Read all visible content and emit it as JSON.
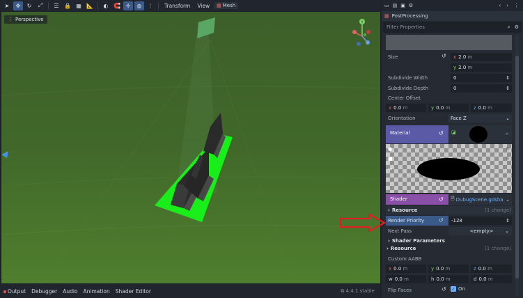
{
  "toolbar": {
    "menu_transform": "Transform",
    "menu_view": "View",
    "menu_mesh": "Mesh"
  },
  "viewport": {
    "perspective_label": "Perspective",
    "gizmo_y": "Y"
  },
  "bottom": {
    "output": "Output",
    "debugger": "Debugger",
    "audio": "Audio",
    "animation": "Animation",
    "shader_editor": "Shader Editor",
    "version": "4.4.1.stable"
  },
  "inspector": {
    "node_name": "PostProcessing",
    "filter_placeholder": "Filter Properties",
    "size_label": "Size",
    "size_x": "2.0",
    "size_y": "2.0",
    "unit_m": "m",
    "subdivide_width_label": "Subdivide Width",
    "subdivide_width": "0",
    "subdivide_depth_label": "Subdivide Depth",
    "subdivide_depth": "0",
    "center_offset_label": "Center Offset",
    "center_x": "0.0",
    "center_y": "0.0",
    "center_z": "0.0",
    "orientation_label": "Orientation",
    "orientation_value": "Face Z",
    "material_label": "Material",
    "shader_label": "Shader",
    "shader_value": "DubugScene.gdsha",
    "resource_label": "Resource",
    "resource_changes": "(1 change)",
    "render_priority_label": "Render Priority",
    "render_priority_value": "-128",
    "next_pass_label": "Next Pass",
    "next_pass_value": "<empty>",
    "shader_params_label": "Shader Parameters",
    "resource2_label": "Resource",
    "resource2_changes": "(1 change)",
    "custom_aabb_label": "Custom AABB",
    "aabb_x": "0.0",
    "aabb_y": "0.0",
    "aabb_z": "0.0",
    "aabb_w": "0.0",
    "aabb_h": "0.0",
    "aabb_d": "0.0",
    "flip_faces_label": "Flip Faces",
    "flip_faces_value": "On",
    "axis_x": "x",
    "axis_y": "y",
    "axis_z": "z",
    "axis_w": "w",
    "axis_h": "h",
    "axis_d": "d"
  },
  "colors": {
    "material_row": "#5b5aa6",
    "shader_row": "#8a4fa6",
    "render_priority_row": "#3a5a8a",
    "arrow": "#e02020",
    "plane_green": "#1aee1a",
    "viewport_green": "#3f6a26"
  }
}
